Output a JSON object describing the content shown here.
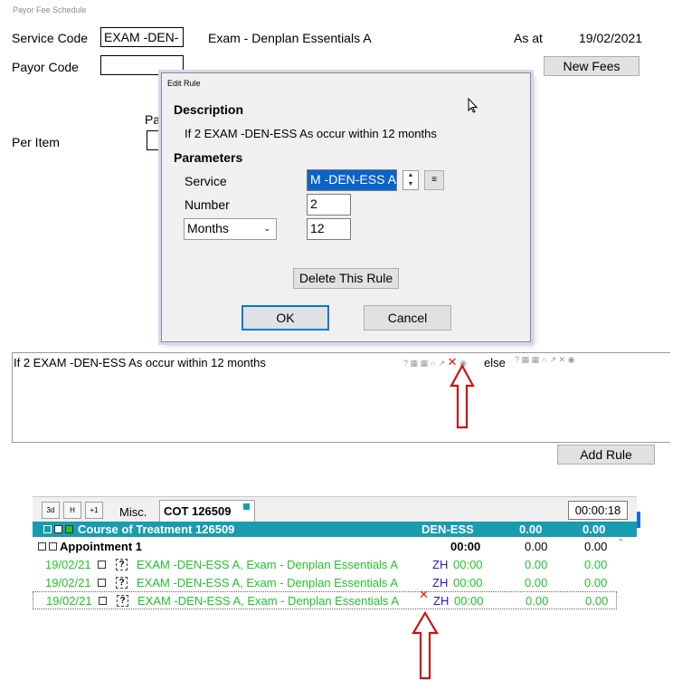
{
  "window": {
    "title": "Payor Fee Schedule"
  },
  "form": {
    "service_code_label": "Service Code",
    "service_code_value": "EXAM -DEN-",
    "service_description": "Exam - Denplan Essentials A",
    "as_at_label": "As at",
    "as_at_value": "19/02/2021",
    "payor_code_label": "Payor Code",
    "payor_code_value": "",
    "new_fees_button": "New Fees",
    "payor_partial_label": "Pay",
    "per_item_label": "Per Item"
  },
  "dialog": {
    "title": "Edit Rule",
    "description_heading": "Description",
    "description_text": "If 2 EXAM -DEN-ESS As occur within 12 months",
    "parameters_heading": "Parameters",
    "service_label": "Service",
    "service_value": "M -DEN-ESS A",
    "number_label": "Number",
    "number_value": "2",
    "period_select": "Months",
    "period_value": "12",
    "delete_button": "Delete This Rule",
    "ok_button": "OK",
    "cancel_button": "Cancel"
  },
  "rules": {
    "rule_text": "If 2 EXAM -DEN-ESS As occur within 12 months",
    "else_label": "else",
    "add_rule_button": "Add Rule"
  },
  "grid": {
    "tabs": [
      "3d",
      "H",
      "+1"
    ],
    "misc_label": "Misc.",
    "cot_tab": "COT 126509",
    "timer": "00:00:18",
    "course": {
      "label": "Course of Treatment 126509",
      "code": "DEN-ESS",
      "val1": "0.00",
      "val2": "0.00"
    },
    "appointment": {
      "label": "Appointment 1",
      "time": "00:00",
      "val1": "0.00",
      "val2": "0.00"
    },
    "rows": [
      {
        "date": "19/02/21",
        "q": "?",
        "desc": "EXAM -DEN-ESS A, Exam - Denplan Essentials A",
        "who": "ZH",
        "time": "00:00",
        "val1": "0.00",
        "val2": "0.00"
      },
      {
        "date": "19/02/21",
        "q": "?",
        "desc": "EXAM -DEN-ESS A, Exam - Denplan Essentials A",
        "who": "ZH",
        "time": "00:00",
        "val1": "0.00",
        "val2": "0.00"
      },
      {
        "date": "19/02/21",
        "q": "?",
        "desc": "EXAM -DEN-ESS A, Exam - Denplan Essentials A",
        "who": "ZH",
        "time": "00:00",
        "val1": "0.00",
        "val2": "0.00"
      }
    ]
  },
  "colors": {
    "course_bar": "#1a9cb0",
    "item_green": "#22c32a",
    "arrow_red": "#cc1111",
    "selection_blue": "#0a64c8"
  },
  "icons": [
    "help-icon",
    "arrow-down-icon",
    "flag-icon",
    "sort-icon",
    "delete-x-icon",
    "refresh-icon",
    "spin-up-icon",
    "spin-down-icon",
    "list-icon",
    "chevron-down-icon",
    "mouse-cursor-icon"
  ]
}
